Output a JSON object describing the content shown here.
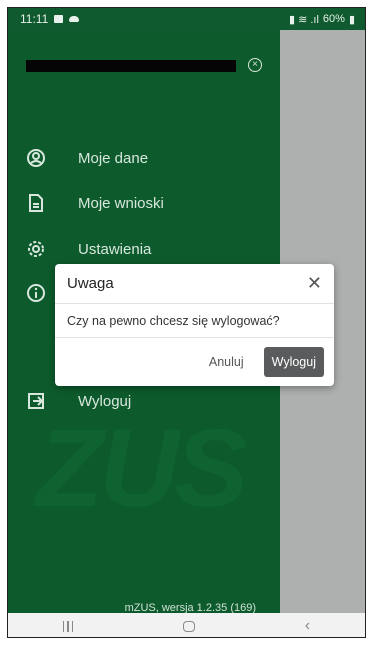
{
  "status_bar": {
    "time": "11:11",
    "battery": "60%"
  },
  "drawer": {
    "menu": [
      {
        "label": "Moje dane",
        "icon": "user-circle-icon"
      },
      {
        "label": "Moje wnioski",
        "icon": "document-icon"
      },
      {
        "label": "Ustawienia",
        "icon": "gear-icon"
      },
      {
        "label": "",
        "icon": "info-icon"
      },
      {
        "label": "Wyloguj",
        "icon": "logout-icon"
      }
    ],
    "watermark": "ZUS",
    "version": "mZUS, wersja 1.2.35 (169)"
  },
  "dialog": {
    "title": "Uwaga",
    "message": "Czy na pewno chcesz się wylogować?",
    "cancel_label": "Anuluj",
    "confirm_label": "Wyloguj"
  }
}
